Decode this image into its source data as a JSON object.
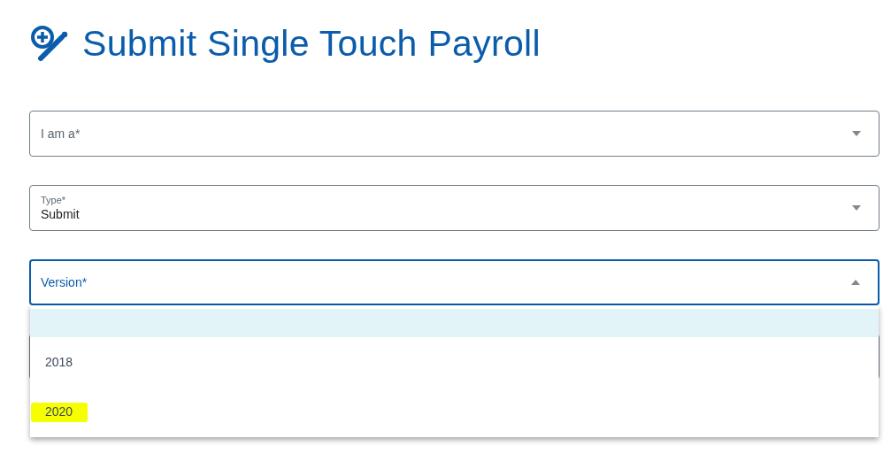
{
  "page": {
    "title": "Submit Single Touch Payroll"
  },
  "fields": [
    {
      "label": "I am a*",
      "expanded": false
    },
    {
      "label": "Type*",
      "value": "Submit",
      "expanded": false
    },
    {
      "label": "Version*",
      "expanded": true,
      "options": [
        {
          "kind": "blank",
          "selected": true,
          "highlighted": false
        },
        {
          "kind": "text",
          "label": "2018",
          "selected": false,
          "highlighted": false
        },
        {
          "kind": "text",
          "label": "2020",
          "selected": false,
          "highlighted": true
        }
      ]
    }
  ]
}
